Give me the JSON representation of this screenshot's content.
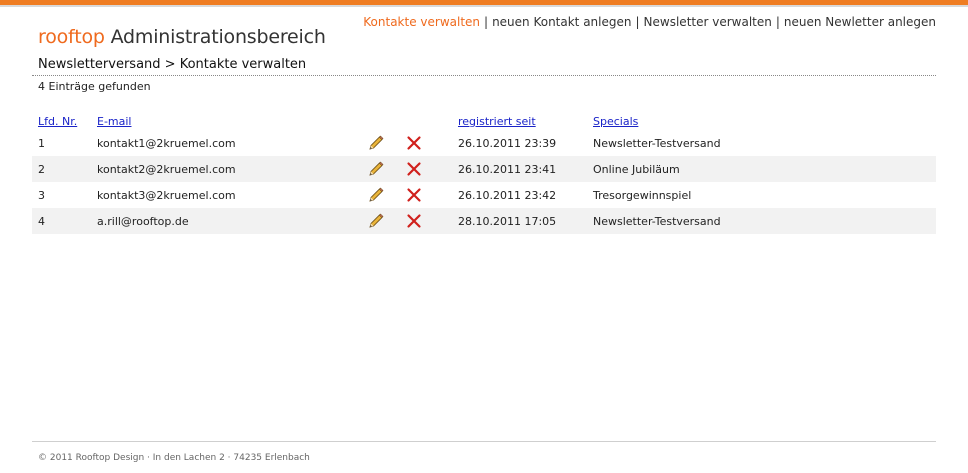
{
  "header": {
    "brand": "rooftop",
    "title": "Administrationsbereich",
    "nav": [
      {
        "label": "Kontakte verwalten",
        "active": true
      },
      {
        "label": "neuen Kontakt anlegen",
        "active": false
      },
      {
        "label": "Newsletter verwalten",
        "active": false
      },
      {
        "label": "neuen Newletter anlegen",
        "active": false
      }
    ],
    "nav_separator": "|"
  },
  "breadcrumb": "Newsletterversand > Kontakte verwalten",
  "result_count": "4 Einträge gefunden",
  "table": {
    "headers": {
      "number": "Lfd. Nr.",
      "email": "E-mail",
      "registered": "registriert seit",
      "specials": "Specials"
    },
    "rows": [
      {
        "number": "1",
        "email": "kontakt1@2kruemel.com",
        "registered": "26.10.2011 23:39",
        "specials": "Newsletter-Testversand"
      },
      {
        "number": "2",
        "email": "kontakt2@2kruemel.com",
        "registered": "26.10.2011 23:41",
        "specials": "Online Jubiläum"
      },
      {
        "number": "3",
        "email": "kontakt3@2kruemel.com",
        "registered": "26.10.2011 23:42",
        "specials": "Tresorgewinnspiel"
      },
      {
        "number": "4",
        "email": "a.rill@rooftop.de",
        "registered": "28.10.2011 17:05",
        "specials": "Newsletter-Testversand"
      }
    ],
    "row_icons": [
      "pencil-icon",
      "delete-x-icon"
    ]
  },
  "footer": "© 2011 Rooftop Design  ·  In den Lachen 2  ·  74235 Erlenbach",
  "colors": {
    "accent": "#ef6a1e",
    "link": "#1a23c8",
    "delete": "#d0201c",
    "row_alt": "#f2f2f2"
  }
}
